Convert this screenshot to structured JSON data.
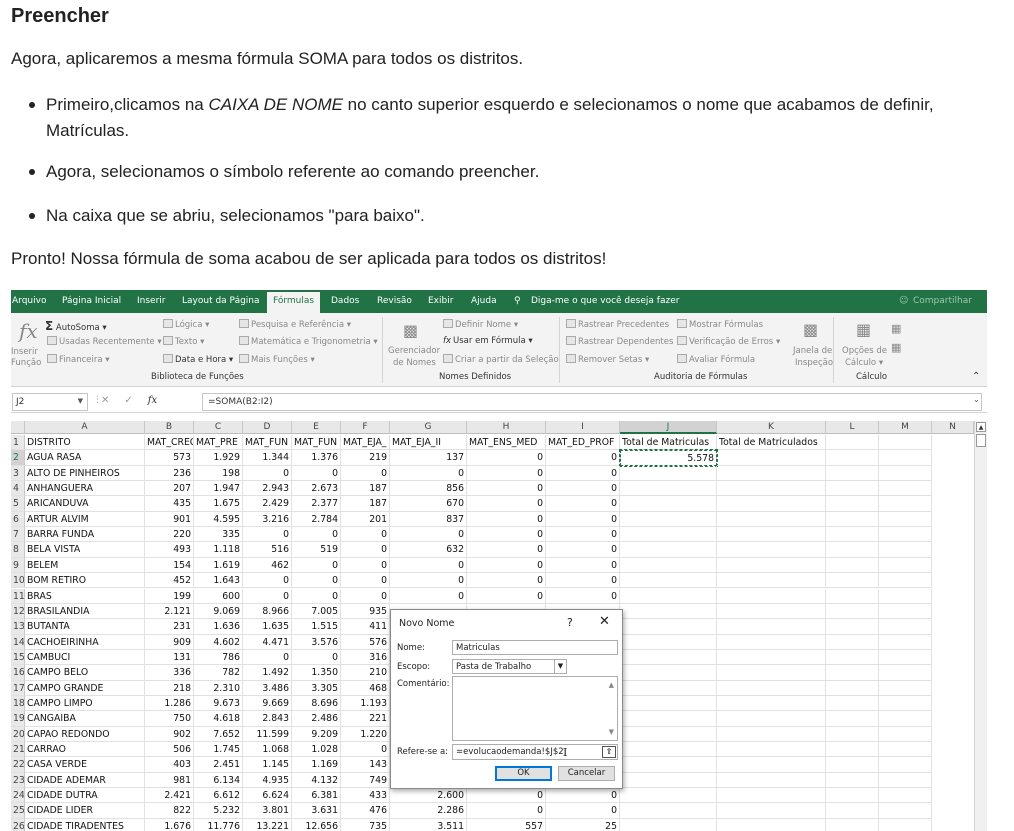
{
  "article": {
    "heading": "Preencher",
    "intro": "Agora, aplicaremos a mesma fórmula SOMA para todos os distritos.",
    "bullets": {
      "b1_pre": "Primeiro,clicamos na ",
      "b1_em": "CAIXA DE NOME",
      "b1_post": " no canto superior esquerdo e selecionamos o nome que acabamos de definir, Matrículas.",
      "b2": "Agora, selecionamos o símbolo referente ao comando preencher.",
      "b3": "Na caixa que se abriu, selecionamos \"para baixo\"."
    },
    "outro": "Pronto! Nossa fórmula de soma acabou de ser aplicada para todos os distritos!"
  },
  "excel": {
    "menu": {
      "arquivo": "Arquivo",
      "pagina_inicial": "Página Inicial",
      "inserir": "Inserir",
      "layout": "Layout da Página",
      "formulas": "Fórmulas",
      "dados": "Dados",
      "revisao": "Revisão",
      "exibir": "Exibir",
      "ajuda": "Ajuda",
      "tell_me": "Diga-me o que você deseja fazer",
      "share": "Compartilhar"
    },
    "ribbon": {
      "inserir_funcao_1": "Inserir",
      "inserir_funcao_2": "Função",
      "autosoma": "AutoSoma",
      "usadas": "Usadas Recentemente",
      "financeira": "Financeira",
      "logica": "Lógica",
      "texto": "Texto",
      "data_hora": "Data e Hora",
      "pesquisa": "Pesquisa e Referência",
      "matematica": "Matemática e Trigonometria",
      "mais_funcoes": "Mais Funções",
      "grp_biblioteca": "Biblioteca de Funções",
      "gerenciador_1": "Gerenciador",
      "gerenciador_2": "de Nomes",
      "definir_nome": "Definir Nome",
      "usar_formula": "Usar em Fórmula",
      "criar_selecao": "Criar a partir da Seleção",
      "grp_nomes": "Nomes Definidos",
      "rastrear_prec": "Rastrear Precedentes",
      "rastrear_dep": "Rastrear Dependentes",
      "remover_setas": "Remover Setas",
      "mostrar_formulas": "Mostrar Fórmulas",
      "verificacao": "Verificação de Erros",
      "avaliar": "Avaliar Fórmula",
      "grp_auditoria": "Auditoria de Fórmulas",
      "janela_1": "Janela de",
      "janela_2": "Inspeção",
      "opcoes_1": "Opções de",
      "opcoes_2": "Cálculo",
      "grp_calculo": "Cálculo"
    },
    "namebox": "J2",
    "formula": "=SOMA(B2:I2)",
    "columns": [
      "A",
      "B",
      "C",
      "D",
      "E",
      "F",
      "G",
      "H",
      "I",
      "J",
      "K",
      "L",
      "M",
      "N"
    ],
    "header_row": [
      "DISTRITO",
      "MAT_CREC",
      "MAT_PRE",
      "MAT_FUN",
      "MAT_FUN",
      "MAT_EJA_",
      "MAT_EJA_II",
      "MAT_ENS_MED",
      "MAT_ED_PROF",
      "Total de Matriculas",
      "Total de Matriculados"
    ],
    "rows": [
      [
        "AGUA RASA",
        "573",
        "1.929",
        "1.344",
        "1.376",
        "219",
        "137",
        "0",
        "0",
        "5.578"
      ],
      [
        "ALTO DE PINHEIROS",
        "236",
        "198",
        "0",
        "0",
        "0",
        "0",
        "0",
        "0",
        ""
      ],
      [
        "ANHANGUERA",
        "207",
        "1.947",
        "2.943",
        "2.673",
        "187",
        "856",
        "0",
        "0",
        ""
      ],
      [
        "ARICANDUVA",
        "435",
        "1.675",
        "2.429",
        "2.377",
        "187",
        "670",
        "0",
        "0",
        ""
      ],
      [
        "ARTUR ALVIM",
        "901",
        "4.595",
        "3.216",
        "2.784",
        "201",
        "837",
        "0",
        "0",
        ""
      ],
      [
        "BARRA FUNDA",
        "220",
        "335",
        "0",
        "0",
        "0",
        "0",
        "0",
        "0",
        ""
      ],
      [
        "BELA VISTA",
        "493",
        "1.118",
        "516",
        "519",
        "0",
        "632",
        "0",
        "0",
        ""
      ],
      [
        "BELEM",
        "154",
        "1.619",
        "462",
        "0",
        "0",
        "0",
        "0",
        "0",
        ""
      ],
      [
        "BOM RETIRO",
        "452",
        "1.643",
        "0",
        "0",
        "0",
        "0",
        "0",
        "0",
        ""
      ],
      [
        "BRAS",
        "199",
        "600",
        "0",
        "0",
        "0",
        "0",
        "0",
        "0",
        ""
      ],
      [
        "BRASILANDIA",
        "2.121",
        "9.069",
        "8.966",
        "7.005",
        "935",
        "",
        "",
        "",
        ""
      ],
      [
        "BUTANTA",
        "231",
        "1.636",
        "1.635",
        "1.515",
        "411",
        "",
        "",
        "",
        ""
      ],
      [
        "CACHOEIRINHA",
        "909",
        "4.602",
        "4.471",
        "3.576",
        "576",
        "",
        "",
        "",
        ""
      ],
      [
        "CAMBUCI",
        "131",
        "786",
        "0",
        "0",
        "316",
        "",
        "",
        "",
        ""
      ],
      [
        "CAMPO BELO",
        "336",
        "782",
        "1.492",
        "1.350",
        "210",
        "",
        "",
        "",
        ""
      ],
      [
        "CAMPO GRANDE",
        "218",
        "2.310",
        "3.486",
        "3.305",
        "468",
        "",
        "",
        "",
        ""
      ],
      [
        "CAMPO LIMPO",
        "1.286",
        "9.673",
        "9.669",
        "8.696",
        "1.193",
        "",
        "",
        "",
        ""
      ],
      [
        "CANGAIBA",
        "750",
        "4.618",
        "2.843",
        "2.486",
        "221",
        "",
        "",
        "",
        ""
      ],
      [
        "CAPAO REDONDO",
        "902",
        "7.652",
        "11.599",
        "9.209",
        "1.220",
        "",
        "",
        "",
        ""
      ],
      [
        "CARRAO",
        "506",
        "1.745",
        "1.068",
        "1.028",
        "0",
        "",
        "",
        "",
        ""
      ],
      [
        "CASA VERDE",
        "403",
        "2.451",
        "1.145",
        "1.169",
        "143",
        "",
        "",
        "",
        ""
      ],
      [
        "CIDADE ADEMAR",
        "981",
        "6.134",
        "4.935",
        "4.132",
        "749",
        "",
        "",
        "",
        ""
      ],
      [
        "CIDADE DUTRA",
        "2.421",
        "6.612",
        "6.624",
        "6.381",
        "433",
        "2.600",
        "0",
        "0",
        ""
      ],
      [
        "CIDADE LIDER",
        "822",
        "5.232",
        "3.801",
        "3.631",
        "476",
        "2.286",
        "0",
        "0",
        ""
      ],
      [
        "CIDADE TIRADENTES",
        "1.676",
        "11.776",
        "13.221",
        "12.656",
        "735",
        "3.511",
        "557",
        "25",
        ""
      ]
    ],
    "dialog": {
      "title": "Novo Nome",
      "help": "?",
      "close": "✕",
      "nome_label": "Nome:",
      "nome_value": "Matriculas",
      "escopo_label": "Escopo:",
      "escopo_value": "Pasta de Trabalho",
      "comentario_label": "Comentário:",
      "comentario_value": "",
      "refere_label": "Refere-se a:",
      "refere_value": "=evolucaodemanda!$J$2",
      "ok": "OK",
      "cancel": "Cancelar"
    }
  }
}
